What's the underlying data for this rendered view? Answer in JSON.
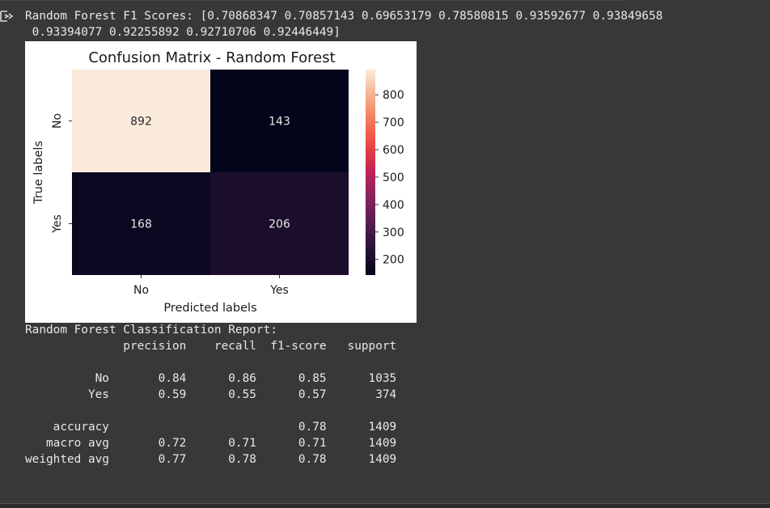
{
  "f1_line1": "Random Forest F1 Scores: [0.70868347 0.70857143 0.69653179 0.78580815 0.93592677 0.93849658",
  "f1_line2": " 0.93394077 0.92255892 0.92710706 0.92446449]",
  "icon": "output-toggle-icon",
  "chart_data": {
    "type": "heatmap",
    "title": "Confusion Matrix - Random Forest",
    "xlabel": "Predicted labels",
    "ylabel": "True labels",
    "x_categories": [
      "No",
      "Yes"
    ],
    "y_categories": [
      "No",
      "Yes"
    ],
    "values": [
      [
        892,
        143
      ],
      [
        168,
        206
      ]
    ],
    "colorbar": {
      "min": 143,
      "max": 892,
      "ticks": [
        "200",
        "300",
        "400",
        "500",
        "600",
        "700",
        "800"
      ]
    }
  },
  "report": {
    "title": "Random Forest Classification Report:",
    "header": "              precision    recall  f1-score   support",
    "rows": [
      "          No       0.84      0.86      0.85      1035",
      "         Yes       0.59      0.55      0.57       374",
      "",
      "    accuracy                           0.78      1409",
      "   macro avg       0.72      0.71      0.71      1409",
      "weighted avg       0.77      0.78      0.78      1409"
    ]
  }
}
